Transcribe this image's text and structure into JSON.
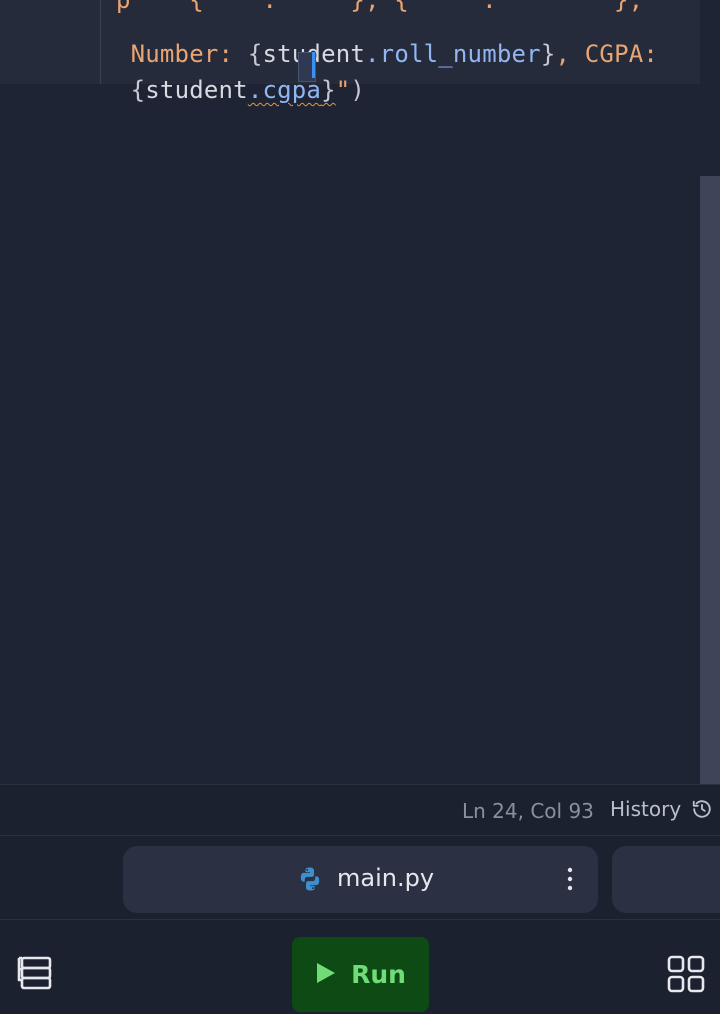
{
  "editor": {
    "partial_line": "   p    {    .     }, {     .        },  ",
    "line1": {
      "str1": "Number: ",
      "brace_open": "{",
      "ident": "student",
      "prop": ".roll_number",
      "brace_close": "}",
      "str2": ", CGPA:"
    },
    "line2": {
      "brace_open": "{",
      "ident": "student",
      "prop": ".cgpa",
      "brace_close": "}",
      "quote": "\"",
      "paren": ")"
    }
  },
  "status_bar": {
    "cursor_position": "Ln 24, Col 93",
    "history_label": "History"
  },
  "tabs": [
    {
      "label": "main.py",
      "icon": "python-icon"
    }
  ],
  "toolbar": {
    "run_label": "Run"
  },
  "colors": {
    "background": "#1f2434",
    "string": "#e8a574",
    "property": "#91b6f2",
    "run_bg": "#0d4a14",
    "run_text": "#6fdc78"
  }
}
